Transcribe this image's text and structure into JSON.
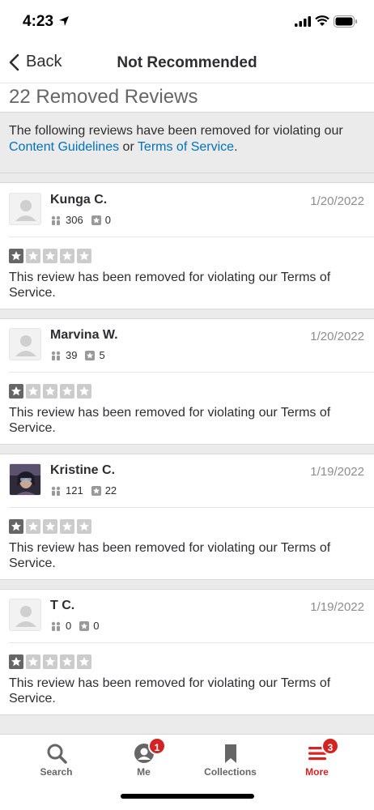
{
  "status_bar": {
    "time": "4:23"
  },
  "nav": {
    "back_label": "Back",
    "title": "Not Recommended"
  },
  "page": {
    "heading": "22 Removed Reviews"
  },
  "notice": {
    "text_before": "The following reviews have been removed for violating our ",
    "link1": "Content Guidelines",
    "text_middle": " or ",
    "link2": "Terms of Service",
    "text_after": "."
  },
  "reviews": [
    {
      "name": "Kunga C.",
      "friends": "306",
      "review_count": "0",
      "date": "1/20/2022",
      "rating": 1,
      "text": "This review has been removed for violating our Terms of Service.",
      "avatar": "default-avatar-icon"
    },
    {
      "name": "Marvina W.",
      "friends": "39",
      "review_count": "5",
      "date": "1/20/2022",
      "rating": 1,
      "text": "This review has been removed for violating our Terms of Service.",
      "avatar": "default-avatar-icon"
    },
    {
      "name": "Kristine C.",
      "friends": "121",
      "review_count": "22",
      "date": "1/19/2022",
      "rating": 1,
      "text": "This review has been removed for violating our Terms of Service.",
      "avatar": "user-photo"
    },
    {
      "name": "T C.",
      "friends": "0",
      "review_count": "0",
      "date": "1/19/2022",
      "rating": 1,
      "text": "This review has been removed for violating our Terms of Service.",
      "avatar": "default-avatar-icon"
    }
  ],
  "tabs": [
    {
      "label": "Search",
      "icon": "search-icon",
      "badge": ""
    },
    {
      "label": "Me",
      "icon": "profile-icon",
      "badge": "1"
    },
    {
      "label": "Collections",
      "icon": "bookmark-icon",
      "badge": ""
    },
    {
      "label": "More",
      "icon": "menu-icon",
      "badge": "3",
      "active": true
    }
  ],
  "colors": {
    "brand_red": "#d32323",
    "link_blue": "#0073bb",
    "text": "#2d2e2f",
    "muted": "#8d8d8d"
  }
}
